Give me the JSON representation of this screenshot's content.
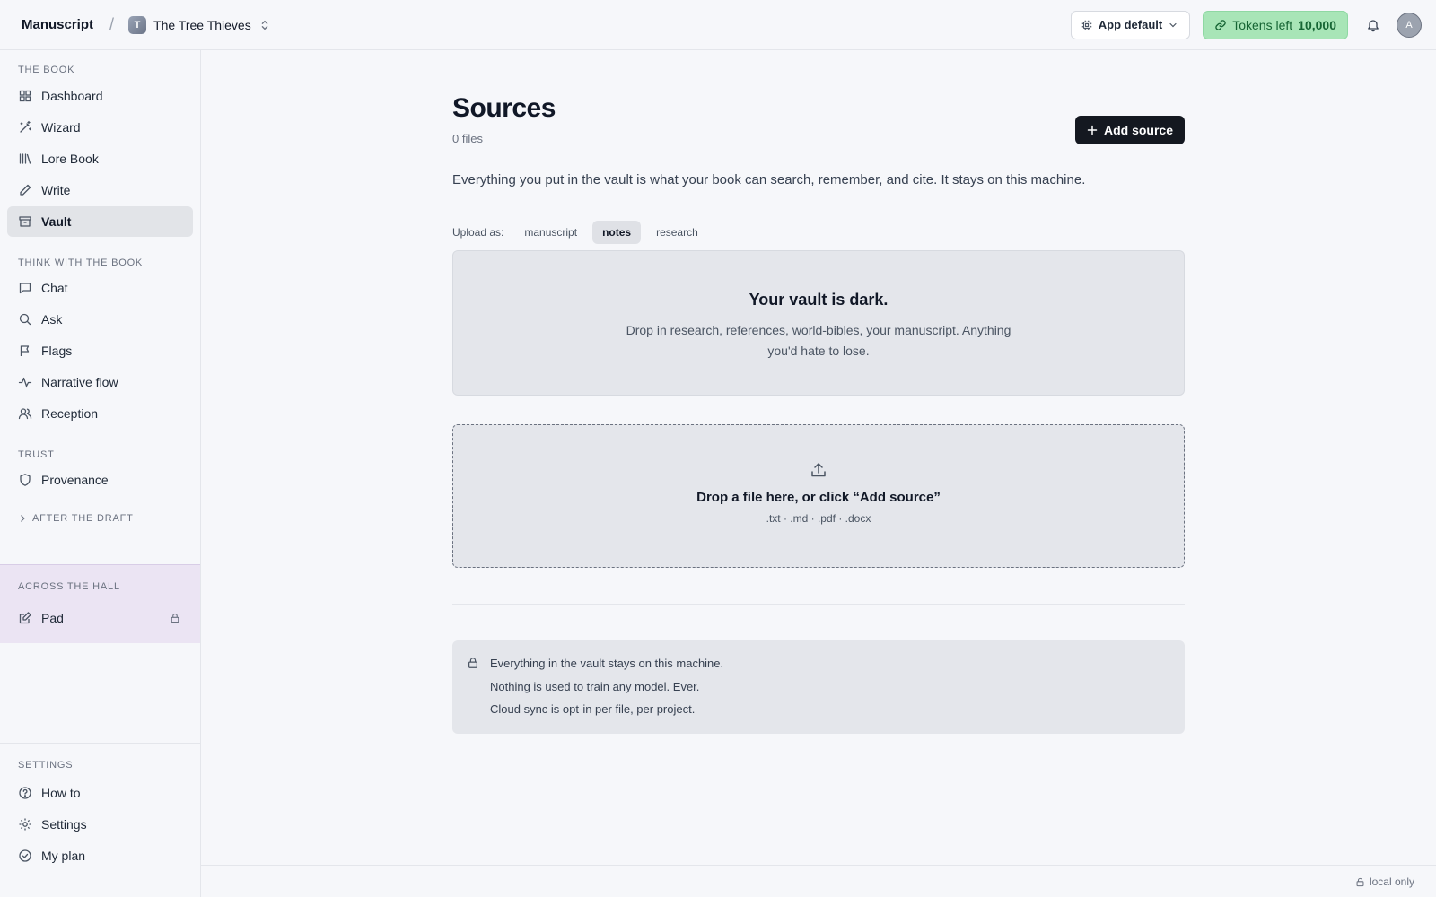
{
  "header": {
    "brand": "Manuscript",
    "separator": "/",
    "project_initial": "T",
    "project_name": "The Tree Thieves",
    "model_select": "App default",
    "tokens_label": "Tokens left",
    "tokens_value": "10,000",
    "avatar_initial": "A"
  },
  "sidebar": {
    "sections": {
      "the_book": "THE BOOK",
      "think": "THINK WITH THE BOOK",
      "trust": "TRUST",
      "after_draft": "AFTER THE DRAFT",
      "across_hall": "ACROSS THE HALL",
      "settings": "SETTINGS"
    },
    "items": {
      "dashboard": "Dashboard",
      "wizard": "Wizard",
      "lore_book": "Lore Book",
      "write": "Write",
      "vault": "Vault",
      "chat": "Chat",
      "ask": "Ask",
      "flags": "Flags",
      "narrative_flow": "Narrative flow",
      "reception": "Reception",
      "provenance": "Provenance",
      "pad": "Pad",
      "how_to": "How to",
      "settings": "Settings",
      "my_plan": "My plan"
    },
    "active_item": "Vault"
  },
  "main": {
    "title": "Sources",
    "file_count": "0 files",
    "add_button": "Add source",
    "intro": "Everything you put in the vault is what your book can search, remember, and cite. It stays on this machine.",
    "upload_as_label": "Upload as:",
    "upload_types": [
      "manuscript",
      "notes",
      "research"
    ],
    "upload_selected": "notes",
    "empty_title": "Your vault is dark.",
    "empty_desc": "Drop in research, references, world-bibles, your manuscript. Anything you'd hate to lose.",
    "dropzone_title": "Drop a file here, or click “Add source”",
    "dropzone_types": ".txt · .md · .pdf · .docx",
    "privacy_lines": [
      "Everything in the vault stays on this machine.",
      "Nothing is used to train any model. Ever.",
      "Cloud sync is opt-in per file, per project."
    ]
  },
  "status": {
    "local": "local only"
  },
  "colors": {
    "accent_dark": "#141820",
    "tokens_bg": "#a8e5b7",
    "tokens_text": "#166534",
    "across_hall_bg": "#ebe4f3"
  }
}
